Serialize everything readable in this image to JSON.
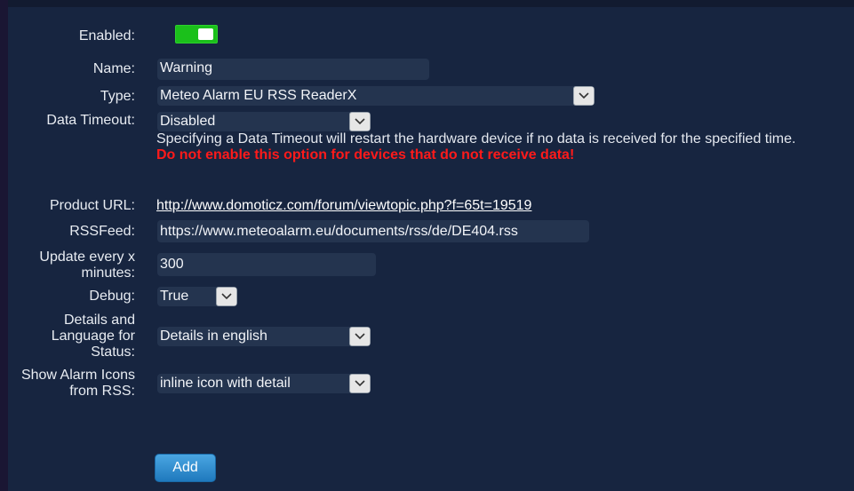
{
  "form": {
    "enabled": {
      "label": "Enabled:",
      "value": true,
      "on_color": "#1bc01b"
    },
    "name": {
      "label": "Name:",
      "value": "Warning"
    },
    "type": {
      "label": "Type:",
      "value": "Meteo Alarm EU RSS ReaderX"
    },
    "data_timeout": {
      "label": "Data Timeout:",
      "value": "Disabled",
      "help": "Specifying a Data Timeout will restart the hardware device if no data is received for the specified time.",
      "warning": "Do not enable this option for devices that do not receive data!",
      "warning_color": "#ff1a1a"
    },
    "product_url": {
      "label": "Product URL:",
      "value": "http://www.domoticz.com/forum/viewtopic.php?f=65t=19519"
    },
    "rss_feed": {
      "label": "RSSFeed:",
      "value": "https://www.meteoalarm.eu/documents/rss/de/DE404.rss"
    },
    "update_every": {
      "label_line1": "Update every x",
      "label_line2": "minutes:",
      "value": "300"
    },
    "debug": {
      "label": "Debug:",
      "value": "True"
    },
    "details_language": {
      "label_line1": "Details and",
      "label_line2": "Language for",
      "label_line3": "Status:",
      "value": "Details in english"
    },
    "alarm_icons": {
      "label_line1": "Show Alarm Icons",
      "label_line2": "from RSS:",
      "value": "inline icon with detail"
    },
    "add_button": {
      "label": "Add"
    }
  },
  "icons": {
    "select_arrow": "chevron-down-icon"
  },
  "colors": {
    "background": "#172540",
    "field_bg": "#24344f",
    "button_accent": "#2f8fd3"
  }
}
